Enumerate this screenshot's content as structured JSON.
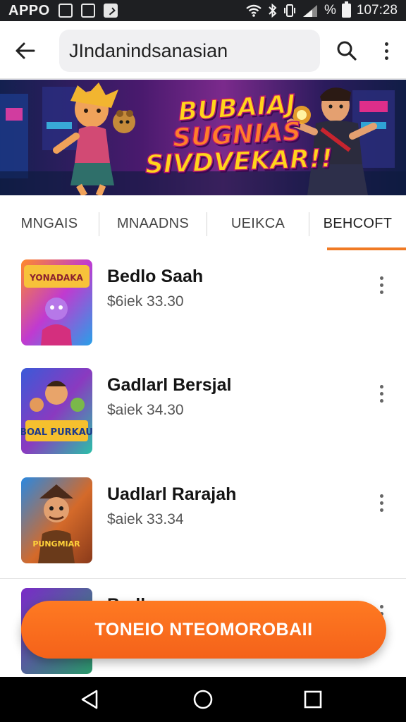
{
  "status_bar": {
    "app_label": "APPO",
    "battery_pct": "%",
    "time": "107:28",
    "icons": [
      "image-icon",
      "checkbox-icon",
      "checkbox-filled-icon",
      "wifi-icon",
      "bluetooth-icon",
      "vibrate-icon",
      "signal-icon",
      "battery-icon"
    ]
  },
  "app_bar": {
    "search_value": "JIndanindsanasian",
    "icons": [
      "back-arrow-icon",
      "search-icon",
      "more-vert-icon"
    ]
  },
  "banner": {
    "line1": "BUBAIAJ",
    "line2": "SUGNIAS",
    "line3": "SIVDVEKAR!!"
  },
  "tabs": [
    {
      "label": "MNGAIS"
    },
    {
      "label": "MNAADNS"
    },
    {
      "label": "UEIKCA"
    },
    {
      "label": "BEHCOFT",
      "selected": true
    }
  ],
  "items": [
    {
      "title": "Bedlo Saah",
      "subtitle": "$6iek 33.30",
      "thumb_text": "YONADAKA"
    },
    {
      "title": "Gadlarl Bersjal",
      "subtitle": "$aiek 34.30",
      "thumb_text": "BOAL PURKAU"
    },
    {
      "title": "Uadlarl Rarajah",
      "subtitle": "$aiek 33.34",
      "thumb_text": "PUNGMIAR"
    },
    {
      "title": "Bedlo",
      "subtitle": "",
      "thumb_text": ""
    }
  ],
  "fab": {
    "label": "TONEIO NTEOMOROBAII"
  },
  "nav_bar": {
    "icons": [
      "nav-back-icon",
      "nav-home-icon",
      "nav-recents-icon"
    ]
  },
  "colors": {
    "accent": "#f4621a",
    "status_bar": "#1e1f22",
    "nav_bar": "#000000",
    "search_bg": "#f0f0f2"
  }
}
